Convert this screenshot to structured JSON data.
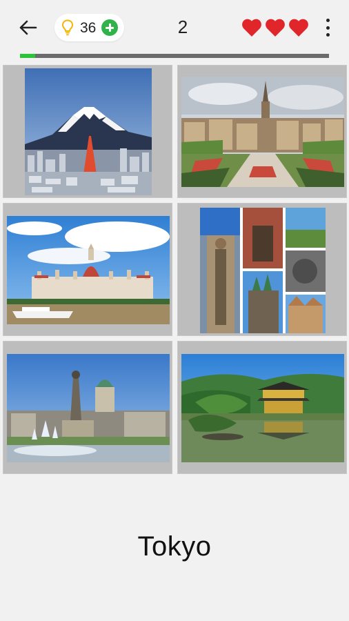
{
  "header": {
    "hints_count": "36",
    "level": "2",
    "lives": 3,
    "progress_fraction": 0.05
  },
  "icons": {
    "back": "arrow-left-icon",
    "hint": "lightbulb-icon",
    "add_hints": "plus-circle-icon",
    "life": "heart-icon",
    "menu": "more-vert-icon"
  },
  "colors": {
    "background": "#f1f1f1",
    "heart": "#e0262b",
    "bulb": "#f4b400",
    "add_button": "#32b24a",
    "progress_fill": "#2cc23a",
    "progress_track": "#6b6b6b"
  },
  "answer": {
    "text": "Tokyo"
  }
}
